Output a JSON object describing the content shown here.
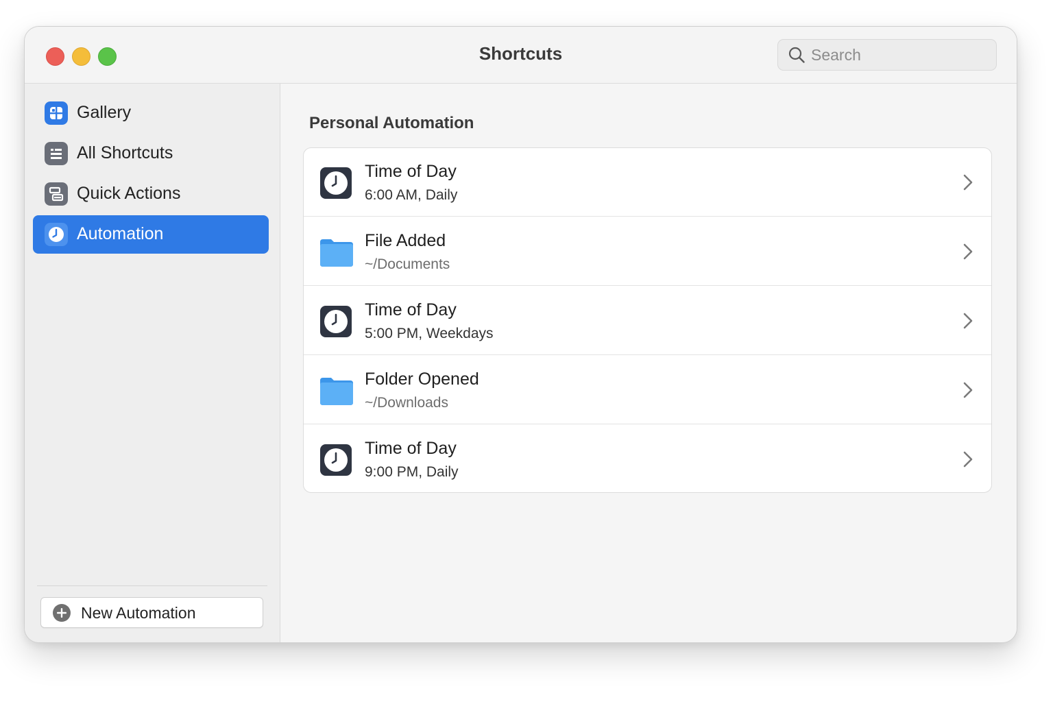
{
  "window": {
    "title": "Shortcuts"
  },
  "search": {
    "placeholder": "Search"
  },
  "sidebar": {
    "items": [
      {
        "label": "Gallery",
        "icon": "gallery-icon",
        "active": false
      },
      {
        "label": "All Shortcuts",
        "icon": "all-shortcuts-icon",
        "active": false
      },
      {
        "label": "Quick Actions",
        "icon": "quick-actions-icon",
        "active": false
      },
      {
        "label": "Automation",
        "icon": "automation-icon",
        "active": true
      }
    ],
    "new_button_label": "New Automation"
  },
  "main": {
    "section_title": "Personal Automation",
    "rows": [
      {
        "title": "Time of Day",
        "subtitle": "6:00 AM, Daily",
        "icon": "clock-icon"
      },
      {
        "title": "File Added",
        "subtitle": "~/Documents",
        "icon": "folder-icon"
      },
      {
        "title": "Time of Day",
        "subtitle": "5:00 PM, Weekdays",
        "icon": "clock-icon"
      },
      {
        "title": "Folder Opened",
        "subtitle": "~/Downloads",
        "icon": "folder-icon"
      },
      {
        "title": "Time of Day",
        "subtitle": "9:00 PM, Daily",
        "icon": "clock-icon"
      }
    ]
  },
  "colors": {
    "accent": "#2f7ae5",
    "close": "#ec5f58",
    "minimize": "#f4bd3a",
    "maximize": "#5ac349",
    "folder": "#4aa3f2",
    "clock_tile": "#2f3542"
  }
}
